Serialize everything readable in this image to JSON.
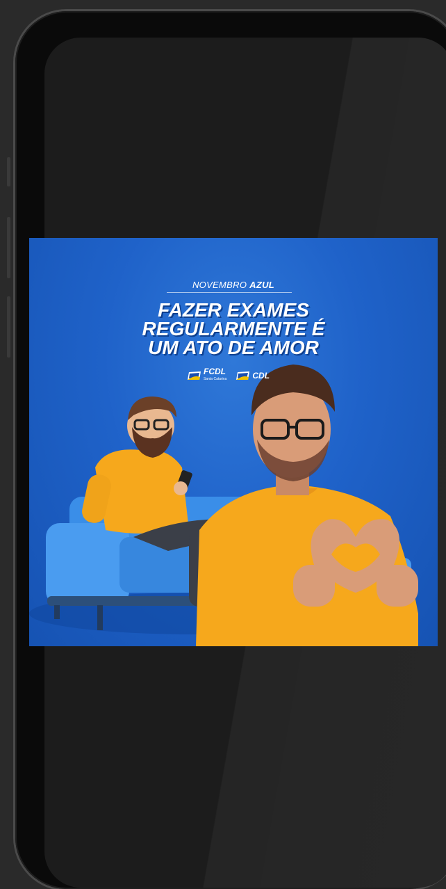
{
  "post": {
    "kicker_light": "NOVEMBRO",
    "kicker_bold": "AZUL",
    "headline": [
      "FAZER EXAMES",
      "REGULARMENTE É",
      "UM ATO DE AMOR"
    ],
    "logos": [
      {
        "name": "FCDL",
        "subtitle": "Santa Catarina"
      },
      {
        "name": "CDL",
        "subtitle": ""
      }
    ]
  },
  "colors": {
    "background": "#2a2a2a",
    "screen": "#1c1c1c",
    "post_blue": "#1f62c9",
    "shirt_yellow": "#f6a81c",
    "sofa_blue": "#3a8ee8"
  }
}
